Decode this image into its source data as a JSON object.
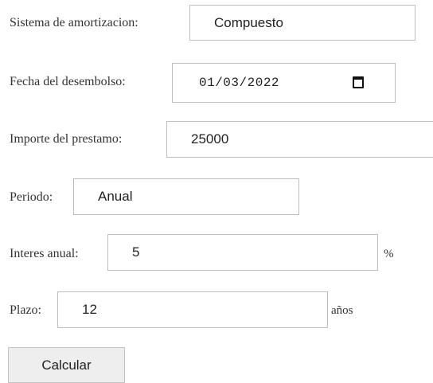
{
  "form": {
    "sistema": {
      "label": "Sistema de amortizacion:",
      "value": "Compuesto"
    },
    "fecha": {
      "label": "Fecha del desembolso:",
      "value": "01/03/2022",
      "icon": "calendar-icon"
    },
    "importe": {
      "label": "Importe del prestamo:",
      "value": "25000"
    },
    "periodo": {
      "label": "Periodo:",
      "value": "Anual"
    },
    "interes": {
      "label": "Interes anual:",
      "value": "5",
      "suffix": "%"
    },
    "plazo": {
      "label": "Plazo:",
      "value": "12",
      "suffix": "años"
    },
    "submit_label": "Calcular"
  }
}
